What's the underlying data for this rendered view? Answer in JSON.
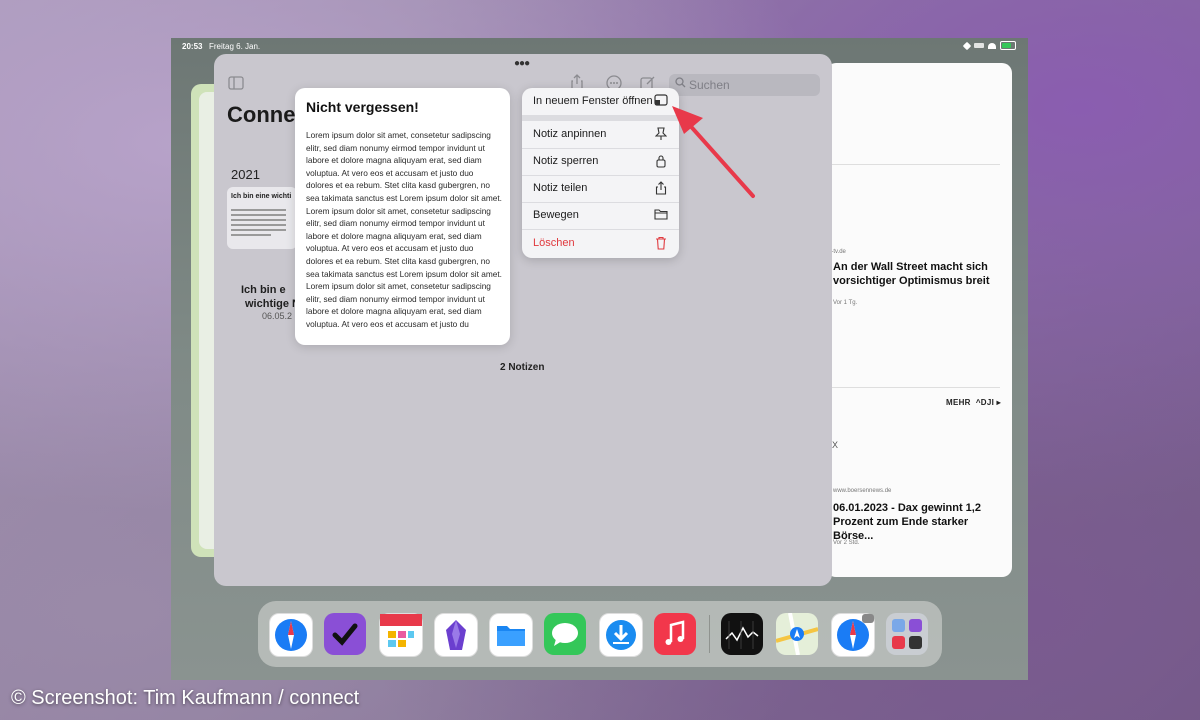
{
  "status_bar": {
    "time": "20:53",
    "date": "Freitag 6. Jan."
  },
  "notes_window": {
    "title": "Conne",
    "search_placeholder": "Suchen",
    "year": "2021",
    "thumbnail_title": "Ich bin eine wichti",
    "thumbnail_caption_line1": "Ich bin e",
    "thumbnail_caption_line2": "wichtige N",
    "thumbnail_date": "06.05.2",
    "note_count": "2 Notizen"
  },
  "note_preview": {
    "title": "Nicht vergessen!",
    "body": "Lorem ipsum dolor sit amet, consetetur sadipscing elitr, sed diam nonumy eirmod tempor invidunt ut labore et dolore magna aliquyam erat, sed diam voluptua. At vero eos et accusam et justo duo dolores et ea rebum. Stet clita kasd gubergren, no sea takimata sanctus est Lorem ipsum dolor sit amet. Lorem ipsum dolor sit amet, consetetur sadipscing elitr, sed diam nonumy eirmod tempor invidunt ut labore et dolore magna aliquyam erat, sed diam voluptua. At vero eos et accusam et justo duo dolores et ea rebum. Stet clita kasd gubergren, no sea takimata sanctus est Lorem ipsum dolor sit amet. Lorem ipsum dolor sit amet, consetetur sadipscing elitr, sed diam nonumy eirmod tempor invidunt ut labore et dolore magna aliquyam erat, sed diam voluptua. At vero eos et accusam et justo du"
  },
  "context_menu": {
    "items": [
      {
        "label": "In neuem Fenster öffnen",
        "icon": "new-window-icon"
      },
      {
        "label": "Notiz anpinnen",
        "icon": "pin-icon"
      },
      {
        "label": "Notiz sperren",
        "icon": "lock-icon"
      },
      {
        "label": "Notiz teilen",
        "icon": "share-icon"
      },
      {
        "label": "Bewegen",
        "icon": "folder-icon"
      },
      {
        "label": "Löschen",
        "icon": "trash-icon",
        "destructive": true
      }
    ],
    "destructive_color": "#e0393e"
  },
  "news_window": {
    "story1_source": "n-tv.de",
    "story1_title": "An der Wall Street macht sich vorsichtiger Optimismus breit",
    "story1_meta": "Vor 1 Tg.",
    "more_label": "MEHR",
    "ticker": "^DJI",
    "dex_label": "EX",
    "story2_source": "www.boersennews.de",
    "story2_title": "06.01.2023 - Dax gewinnt 1,2 Prozent zum Ende starker Börse...",
    "story2_meta": "Vor 2 Std."
  },
  "dock": {
    "apps": [
      "Safari",
      "OmniFocus",
      "Fantastical",
      "Obsidian",
      "Dateien",
      "Nachrichten",
      "Downloader",
      "Musik",
      "Aktien",
      "Karten",
      "Safari",
      "App-Bibliothek"
    ]
  },
  "credit": "© Screenshot: Tim Kaufmann / connect",
  "colors": {
    "arrow": "#e8394a",
    "accent_blue": "#1a7cf5"
  }
}
